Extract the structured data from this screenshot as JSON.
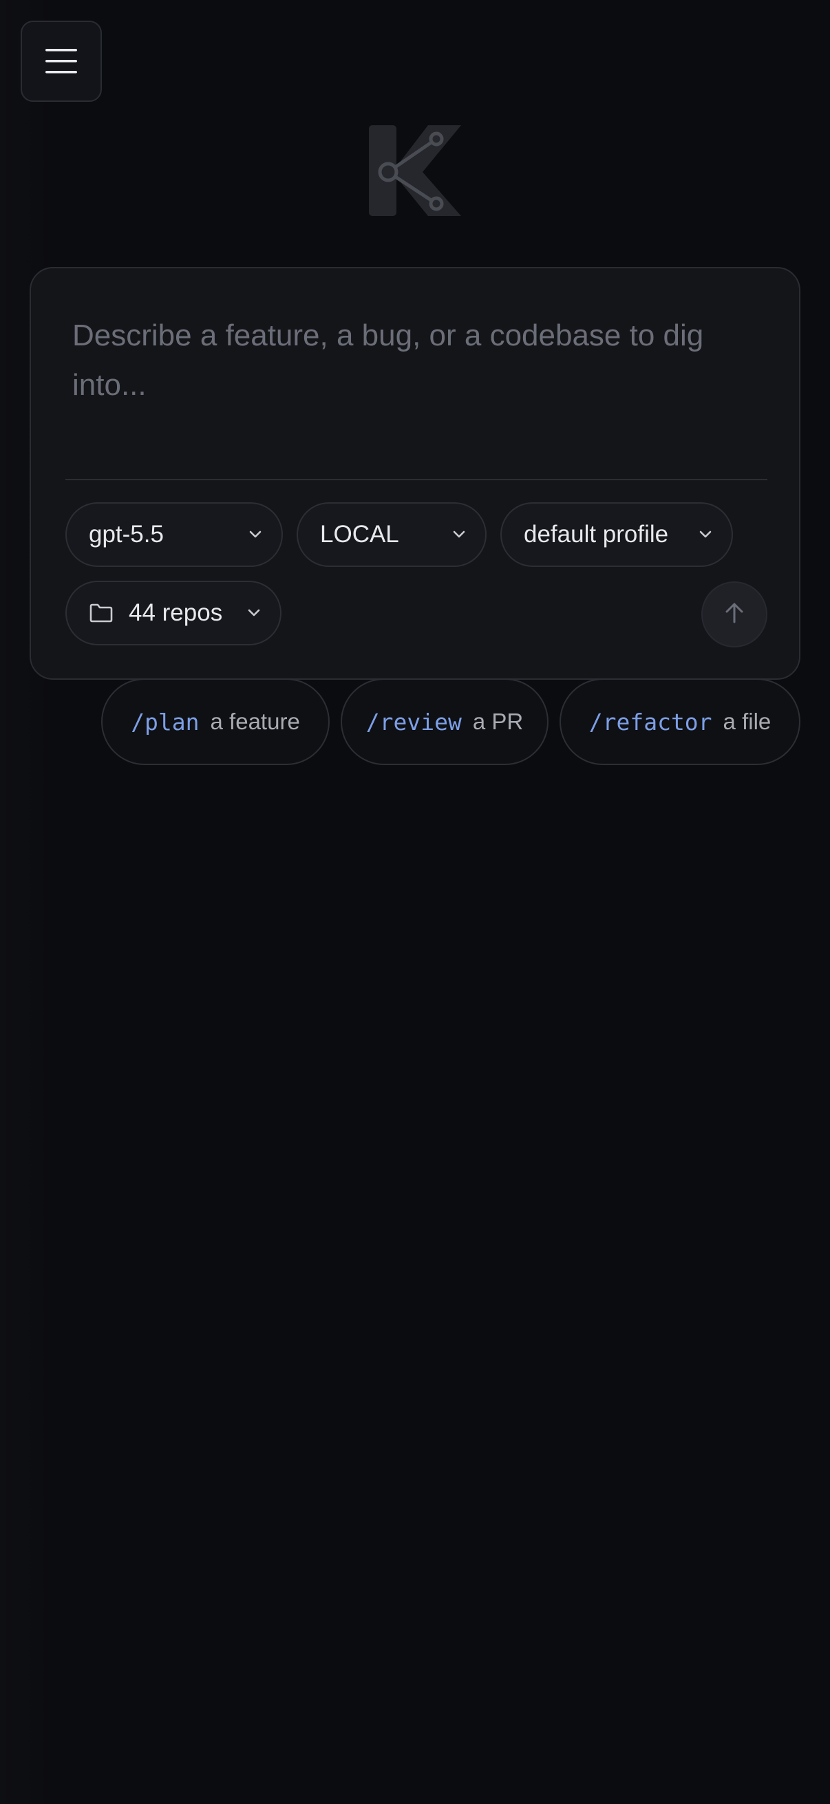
{
  "header": {
    "menu_icon": "hamburger-menu-icon",
    "logo_icon": "k-branch-logo"
  },
  "composer": {
    "placeholder": "Describe a feature, a bug, or a codebase to dig into...",
    "model": {
      "label": "gpt-5.5",
      "icon": "chevron-down-icon"
    },
    "environment": {
      "label": "LOCAL",
      "icon": "chevron-down-icon"
    },
    "profile": {
      "label": "default profile",
      "icon": "chevron-down-icon"
    },
    "repos": {
      "label": "44 repos",
      "icon": "folder-icon"
    },
    "send_icon": "arrow-up-icon"
  },
  "suggestions": [
    {
      "command": "/plan",
      "description": "a feature"
    },
    {
      "command": "/review",
      "description": "a PR"
    },
    {
      "command": "/refactor",
      "description": "a file"
    }
  ],
  "colors": {
    "background": "#0b0c10",
    "card": "#141519",
    "border": "#2a2c33",
    "accent_command": "#7d9fe6",
    "placeholder": "#6b6e78"
  }
}
